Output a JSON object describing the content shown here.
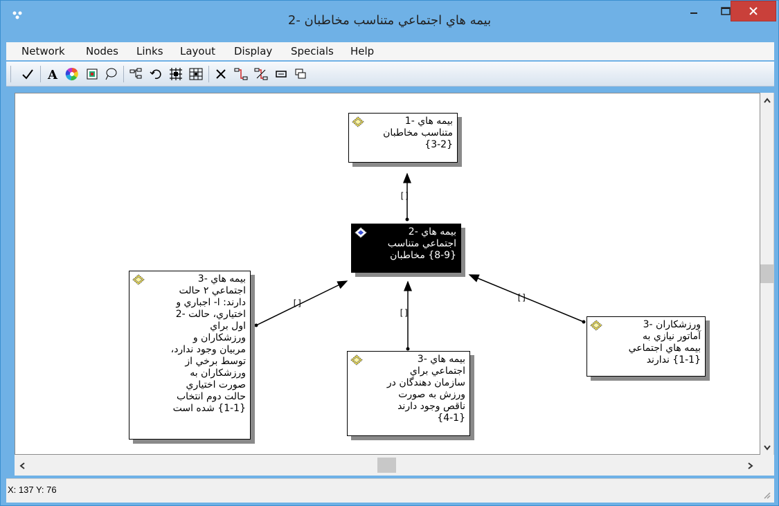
{
  "window": {
    "title": "بيمه هاي اجتماعي متناسب مخاطبان -2"
  },
  "menu": [
    "Network",
    "Nodes",
    "Links",
    "Layout",
    "Display",
    "Specials",
    "Help"
  ],
  "toolbar": {
    "icons": [
      "check-icon",
      "text-a-icon",
      "color-wheel-icon",
      "image-icon",
      "lasso-icon",
      "tree-icon",
      "undo-icon",
      "grid-expand-icon",
      "grid-collapse-icon",
      "delete-x-icon",
      "link-icon",
      "unlink-icon",
      "note-icon",
      "stack-icon"
    ]
  },
  "nodes": {
    "top": {
      "lines": [
        "بيمه هاي -1",
        "متناسب مخاطبان",
        "{3-2}"
      ]
    },
    "center": {
      "lines": [
        "بيمه هاي -2",
        "اجتماعي متناسب",
        "{8-9} مخاطبان"
      ]
    },
    "left": {
      "lines": [
        "بيمه هاي -3",
        "اجتماعي ٢ حالت",
        "دارند: ا- اجباري و",
        "اختياري، حالت -2",
        "اول براي",
        "ورزشكاران و",
        "مربيان وجود ندارد،",
        "توسط برخي از",
        "ورزشكاران به",
        "صورت اختياري",
        "حالت دوم انتخاب",
        "{1-1} شده است"
      ]
    },
    "bottom": {
      "lines": [
        "بيمه هاي -3",
        "اجتماعي براي",
        "سازمان دهندگان در",
        "ورزش به صورت",
        "ناقص وجود دارند",
        "{4-1}"
      ]
    },
    "right": {
      "lines": [
        "ورزشكاران -3",
        "آماتور نيازي به",
        "بيمه هاي اجتماعي",
        "{1-1} ندارند"
      ]
    }
  },
  "edge_labels": {
    "top": "[]",
    "left": "[]",
    "bottom": "[]",
    "right": "[]"
  },
  "status": {
    "coords": "X: 137 Y: 76"
  },
  "colors": {
    "titlebar": "#6fb1e6",
    "close_button": "#c9403a",
    "node_icon": "#f2e040",
    "selected_node_icon": "#3a4fd8"
  }
}
